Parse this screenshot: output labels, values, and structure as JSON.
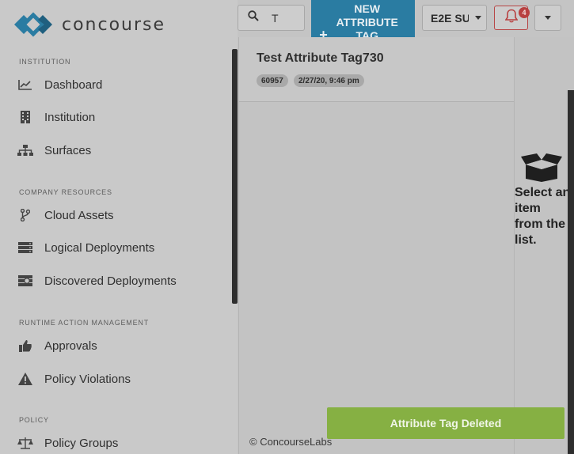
{
  "brand": {
    "name": "concourse"
  },
  "sidebar": {
    "sections": [
      {
        "title": "Institution"
      },
      {
        "title": "Company Resources"
      },
      {
        "title": "Runtime Action Management"
      },
      {
        "title": "Policy"
      }
    ],
    "items": [
      {
        "label": "Dashboard",
        "icon": "chart-line-icon"
      },
      {
        "label": "Institution",
        "icon": "building-icon"
      },
      {
        "label": "Surfaces",
        "icon": "sitemap-icon"
      },
      {
        "label": "Cloud Assets",
        "icon": "code-branch-icon"
      },
      {
        "label": "Logical Deployments",
        "icon": "server-stack-icon"
      },
      {
        "label": "Discovered Deployments",
        "icon": "discovered-icon"
      },
      {
        "label": "Approvals",
        "icon": "thumbs-up-icon"
      },
      {
        "label": "Policy Violations",
        "icon": "warning-icon"
      },
      {
        "label": "Policy Groups",
        "icon": "balance-scale-icon"
      }
    ]
  },
  "topbar": {
    "search_value": "T",
    "new_button_plus": "+",
    "new_button_label": "NEW ATTRIBUTE TAG",
    "env_label": "E2E SU",
    "notification_count": "4"
  },
  "list": {
    "rows": [
      {
        "title": "Test Attribute Tag730",
        "id": "60957",
        "date": "2/27/20, 9:46 pm"
      }
    ]
  },
  "footer": {
    "copyright": "© ConcourseLabs"
  },
  "detail": {
    "empty_message": "Select an item from the list."
  },
  "toast": {
    "message": "Attribute Tag Deleted"
  },
  "colors": {
    "accent": "#2a7ca2",
    "toast": "#86b043",
    "alert": "#b84040"
  }
}
